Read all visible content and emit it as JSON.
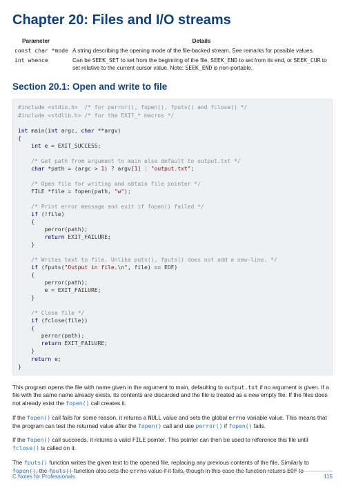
{
  "chapter_title": "Chapter 20: Files and I/O streams",
  "params_table": {
    "header_param": "Parameter",
    "header_details": "Details",
    "row1_param": "const char *mode",
    "row1_details": "A string describing the opening mode of the file-backed stream. See remarks for possible values.",
    "row2_param": "int whence",
    "row2_details_pre": "Can be ",
    "row2_seek_set": "SEEK_SET",
    "row2_mid1": " to set from the beginning of the file, ",
    "row2_seek_end": "SEEK_END",
    "row2_mid2": " to set from its end, or ",
    "row2_seek_cur": "SEEK_CUR",
    "row2_mid3": " to set relative to the current cursor value. Note: ",
    "row2_note_code": "SEEK_END",
    "row2_note_tail": " is non-portable."
  },
  "section_title": "Section 20.1: Open and write to file",
  "code": {
    "l1a": "#include <stdio.h>",
    "l1c": "  /* for perror(), fopen(), fputs() and fclose() */",
    "l2a": "#include <stdlib.h>",
    "l2c": " /* for the EXIT_* macros */",
    "kw_int": "int",
    "main": " main(",
    "argc": " argc, ",
    "kw_char": "char",
    "argv": " **argv)",
    "ob": "{",
    "cb": "}",
    "l5a": "    ",
    "l5b": " e = EXIT_SUCCESS;",
    "c1": "    /* Get path from argument to main else default to output.txt */",
    "l7a": "    ",
    "l7b": " *path = (argc > ",
    "one": "1",
    "l7c": ") ? argv[",
    "l7d": "] : ",
    "s_out": "\"output.txt\"",
    "semi": ";",
    "c2": "    /* Open file for writing and obtain file pointer */",
    "l9a": "    FILE *file = fopen(path, ",
    "s_w": "\"w\"",
    "l9b": ");",
    "c3": "    /* Print error message and exit if fopen() failed */",
    "kw_if": "if",
    "l11": " (!file)",
    "perror": "        perror(path);",
    "kw_return": "return",
    "ret_fail": " EXIT_FAILURE;",
    "c4": "    /* Writes text to file. Unlike puts(), fputs() does not add a new-line. */",
    "l15a": " (fputs(",
    "s_msg1": "\"Output in file.",
    "esc_n": "\\n",
    "s_msg2": "\"",
    "l15b": ", file) == EOF)",
    "e_fail": "        e = EXIT_FAILURE;",
    "c5": "    /* Close file */",
    "l18": " (fclose(file))",
    "perror2": "       perror(path);",
    "ret_fail2": "       ",
    "ret_fail2b": " EXIT_FAILURE;",
    "ret_e_pre": "    ",
    "ret_e": " e;"
  },
  "para1": {
    "t1": "This program opens the file with name given in the argument to main, defaulting to ",
    "c1": "output.txt",
    "t2": " if no argument is given. If a file with the same name already exists, its contents are discarded and the file is treated as a new empty file. If the files does not already exist the ",
    "c2": "fopen()",
    "t3": " call creates it."
  },
  "para2": {
    "t1": "If the ",
    "c1": "fopen()",
    "t2": " call fails for some reason, it returns a ",
    "c2": "NULL",
    "t3": " value and sets the global ",
    "c3": "errno",
    "t4": " variable value. This means that the program can test the returned value after the ",
    "c4": "fopen()",
    "t5": " call and use ",
    "c5": "perror()",
    "t6": " if ",
    "c6": "fopen()",
    "t7": " fails."
  },
  "para3": {
    "t1": "If the ",
    "c1": "fopen()",
    "t2": " call succeeds, it returns a valid ",
    "c2": "FILE",
    "t3": " pointer. This pointer can then be used to reference this file until ",
    "c3": "fclose()",
    "t4": " is called on it."
  },
  "para4": {
    "t1": "The ",
    "c1": "fputs()",
    "t2": " function writes the given text to the opened file, replacing any previous contents of the file. Similarly to ",
    "c2": "fopen()",
    "t3": ", the ",
    "c3": "fputs()",
    "t4": " function also sets the ",
    "c4": "errno",
    "t5": " value if it fails, though in this case the function returns ",
    "c5": "EOF",
    "t6": " to"
  },
  "footer_left": "C Notes for Professionals",
  "footer_page": "115"
}
